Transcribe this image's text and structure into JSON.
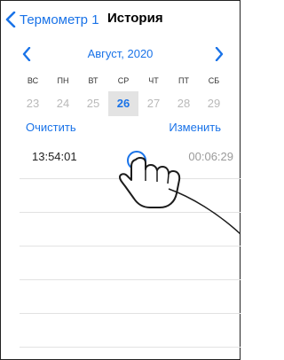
{
  "navbar": {
    "back_label": "Термометр 1",
    "title": "История"
  },
  "calendar": {
    "month_label": "Август, 2020",
    "weekdays": [
      "ВС",
      "ПН",
      "ВТ",
      "СР",
      "ЧТ",
      "ПТ",
      "СБ"
    ],
    "days": [
      "23",
      "24",
      "25",
      "26",
      "27",
      "28",
      "29"
    ],
    "selected_day": "26"
  },
  "actions": {
    "clear_label": "Очистить",
    "edit_label": "Изменить"
  },
  "records": [
    {
      "time": "13:54:01",
      "duration": "00:06:29"
    }
  ],
  "colors": {
    "accent": "#1a73e8",
    "selected_bg": "#e3e3e3",
    "muted": "#b9b9b9"
  }
}
